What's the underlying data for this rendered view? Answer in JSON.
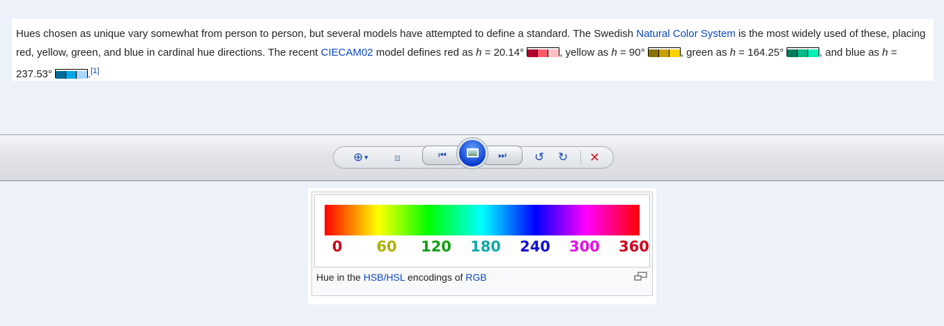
{
  "paragraph": {
    "t1": "Hues chosen as unique vary somewhat from person to person, but several models have attempted to define a standard. The Swedish ",
    "link_ncs": "Natural Color System",
    "t2": " is the most widely used of these, placing red, yellow, green, and blue in cardinal hue directions. The recent ",
    "link_ciecam": "CIECAM02",
    "t3": " model defines red as ",
    "h": "h",
    "red_val": " = 20.14° ",
    "t4": ", yellow as ",
    "yellow_val": " = 90° ",
    "t5": ", green as ",
    "green_val": " = 164.25° ",
    "t6": ", and blue as ",
    "blue_val": " = 237.53° ",
    "t7": ".",
    "ref": "[1]",
    "swatches": {
      "red": [
        "#b00030",
        "#ff5a6a",
        "#ffc0c4"
      ],
      "yellow": [
        "#8a7000",
        "#c8a000",
        "#ffd000"
      ],
      "green": [
        "#007a5a",
        "#00b888",
        "#00f0b8"
      ],
      "blue": [
        "#006a98",
        "#00a8e8",
        "#a8d8ff"
      ]
    }
  },
  "toolbar": {
    "icons": [
      "zoom-icon",
      "fit-window-icon",
      "previous-icon",
      "slideshow-icon",
      "next-icon",
      "rotate-counterclockwise-icon",
      "rotate-clockwise-icon",
      "delete-icon"
    ]
  },
  "figure": {
    "ticks": [
      {
        "label": "0",
        "color": "#c8001a"
      },
      {
        "label": "60",
        "color": "#b0b000"
      },
      {
        "label": "120",
        "color": "#10a010"
      },
      {
        "label": "180",
        "color": "#10a8a8"
      },
      {
        "label": "240",
        "color": "#1010d0"
      },
      {
        "label": "300",
        "color": "#e010e0"
      },
      {
        "label": "360",
        "color": "#d0001a"
      }
    ],
    "caption_t1": "Hue in the ",
    "caption_link1": "HSB/HSL",
    "caption_t2": " encodings of ",
    "caption_link2": "RGB"
  }
}
